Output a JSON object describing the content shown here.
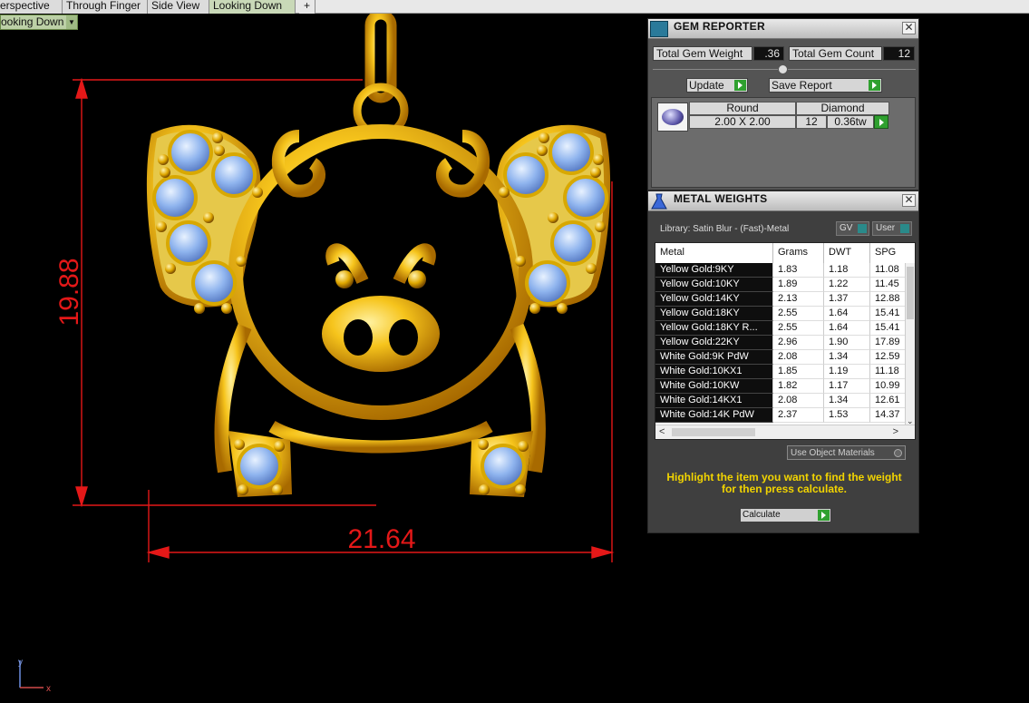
{
  "tabs": [
    {
      "label": "erspective",
      "active": false
    },
    {
      "label": "Through Finger",
      "active": false
    },
    {
      "label": "Side View",
      "active": false
    },
    {
      "label": "Looking Down",
      "active": true
    }
  ],
  "viewport_label": "ooking Down",
  "dimensions": {
    "height": "19.88",
    "width": "21.64"
  },
  "axis": {
    "y": "y",
    "x": "x"
  },
  "colors": {
    "gold": "#f2c01a",
    "gem": "#8fb4ee",
    "dimension": "#e41818"
  },
  "gem_reporter": {
    "title": "GEM REPORTER",
    "total_weight_label": "Total Gem Weight",
    "total_weight_value": ".36",
    "total_count_label": "Total Gem Count",
    "total_count_value": "12",
    "update_label": "Update",
    "save_label": "Save Report",
    "gem_row": {
      "shape": "Round",
      "material": "Diamond",
      "size": "2.00 X 2.00",
      "count": "12",
      "weight": "0.36tw"
    }
  },
  "metal_weights": {
    "title": "METAL WEIGHTS",
    "library": "Library: Satin Blur - (Fast)-Metal",
    "gv_label": "GV",
    "user_label": "User",
    "columns": [
      "Metal",
      "Grams",
      "DWT",
      "SPG"
    ],
    "rows": [
      [
        "Yellow Gold:9KY",
        "1.83",
        "1.18",
        "11.08"
      ],
      [
        "Yellow Gold:10KY",
        "1.89",
        "1.22",
        "11.45"
      ],
      [
        "Yellow Gold:14KY",
        "2.13",
        "1.37",
        "12.88"
      ],
      [
        "Yellow Gold:18KY",
        "2.55",
        "1.64",
        "15.41"
      ],
      [
        "Yellow Gold:18KY R...",
        "2.55",
        "1.64",
        "15.41"
      ],
      [
        "Yellow Gold:22KY",
        "2.96",
        "1.90",
        "17.89"
      ],
      [
        "White Gold:9K PdW",
        "2.08",
        "1.34",
        "12.59"
      ],
      [
        "White Gold:10KX1",
        "1.85",
        "1.19",
        "11.18"
      ],
      [
        "White Gold:10KW",
        "1.82",
        "1.17",
        "10.99"
      ],
      [
        "White Gold:14KX1",
        "2.08",
        "1.34",
        "12.61"
      ],
      [
        "White Gold:14K PdW",
        "2.37",
        "1.53",
        "14.37"
      ]
    ],
    "use_object_materials": "Use Object Materials",
    "hint": "Highlight the item you want to find the weight for then press calculate.",
    "calculate_label": "Calculate"
  }
}
